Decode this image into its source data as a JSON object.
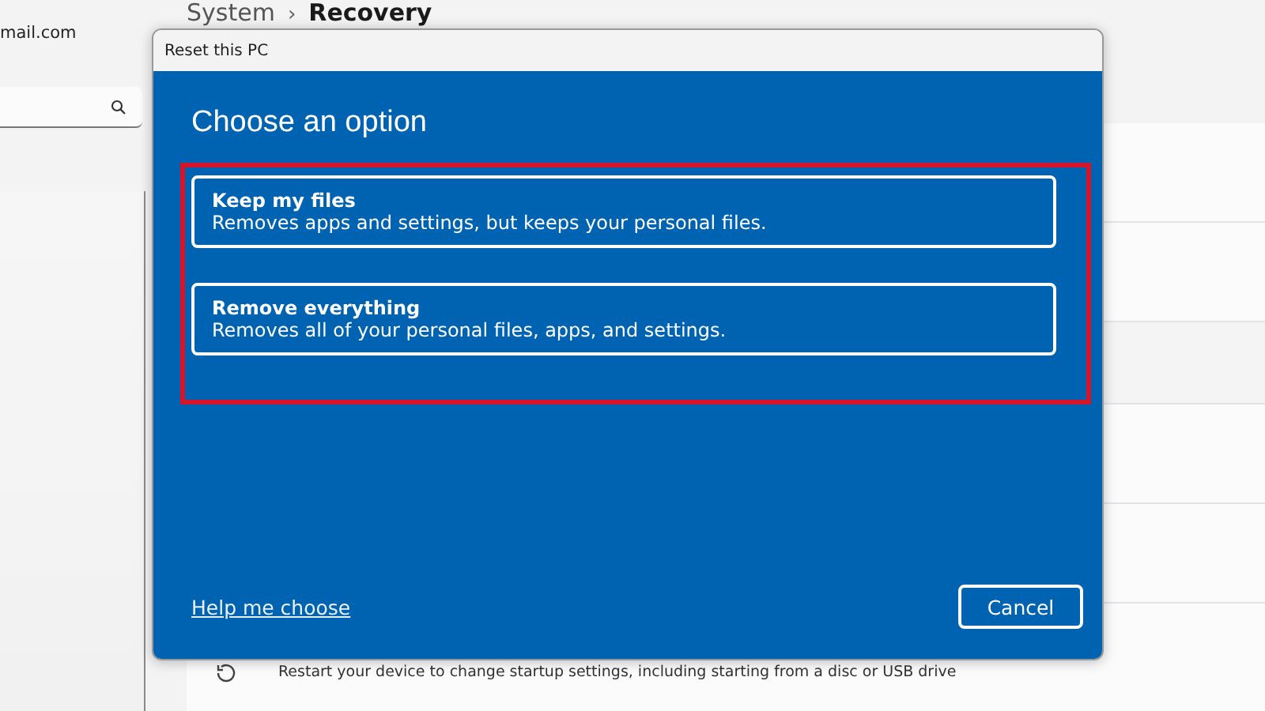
{
  "account": {
    "email": "mail.com"
  },
  "header": {
    "section": "System",
    "separator": "›",
    "page": "Recovery"
  },
  "settings_cards": [
    {
      "description": "Restart your device to change startup settings, including starting from a disc or USB drive"
    }
  ],
  "dialog": {
    "title": "Reset this PC",
    "heading": "Choose an option",
    "options": [
      {
        "title": "Keep my files",
        "description": "Removes apps and settings, but keeps your personal files."
      },
      {
        "title": "Remove everything",
        "description": "Removes all of your personal files, apps, and settings."
      }
    ],
    "help_link": "Help me choose",
    "cancel_button": "Cancel"
  }
}
